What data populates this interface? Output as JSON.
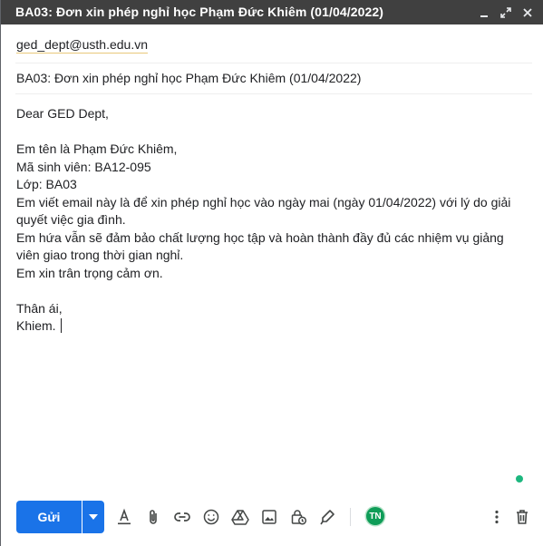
{
  "window": {
    "title": "BA03: Đơn xin phép nghỉ học Phạm Đức Khiêm (01/04/2022)"
  },
  "title_controls": [
    "minimize-icon",
    "expand-icon",
    "close-icon"
  ],
  "compose": {
    "recipient": "ged_dept@usth.edu.vn",
    "subject": "BA03: Đơn xin phép nghỉ học Phạm Đức Khiêm (01/04/2022)",
    "body": {
      "greeting": "Dear GED Dept,",
      "line1": "Em tên là Phạm Đức Khiêm,",
      "line2": "Mã sinh viên: BA12-095",
      "line3": "Lớp: BA03",
      "line4": "Em viết email này là để xin phép nghỉ học vào ngày mai (ngày 01/04/2022) với lý do giải quyết việc gia đình.",
      "line5": "Em hứa vẫn sẽ đảm bảo chất lượng học tập và hoàn thành đầy đủ các nhiệm vụ giảng viên giao trong thời gian nghỉ.",
      "line6": "Em xin trân trọng cảm ơn.",
      "closing": "Thân ái,",
      "signature": "Khiem."
    }
  },
  "toolbar": {
    "send_label": "Gửi",
    "tools": [
      "formatting-icon",
      "attach-icon",
      "link-icon",
      "emoji-icon",
      "drive-icon",
      "photo-icon",
      "confidential-mode-icon",
      "signature-icon"
    ],
    "avatar_initials": "TN",
    "more_options": "more-options-icon",
    "discard": "trash-icon"
  },
  "colors": {
    "titlebar_bg": "#404040",
    "send_blue": "#1a73e8",
    "avatar_green": "#0f9d58",
    "status_dot": "#1db77f"
  }
}
